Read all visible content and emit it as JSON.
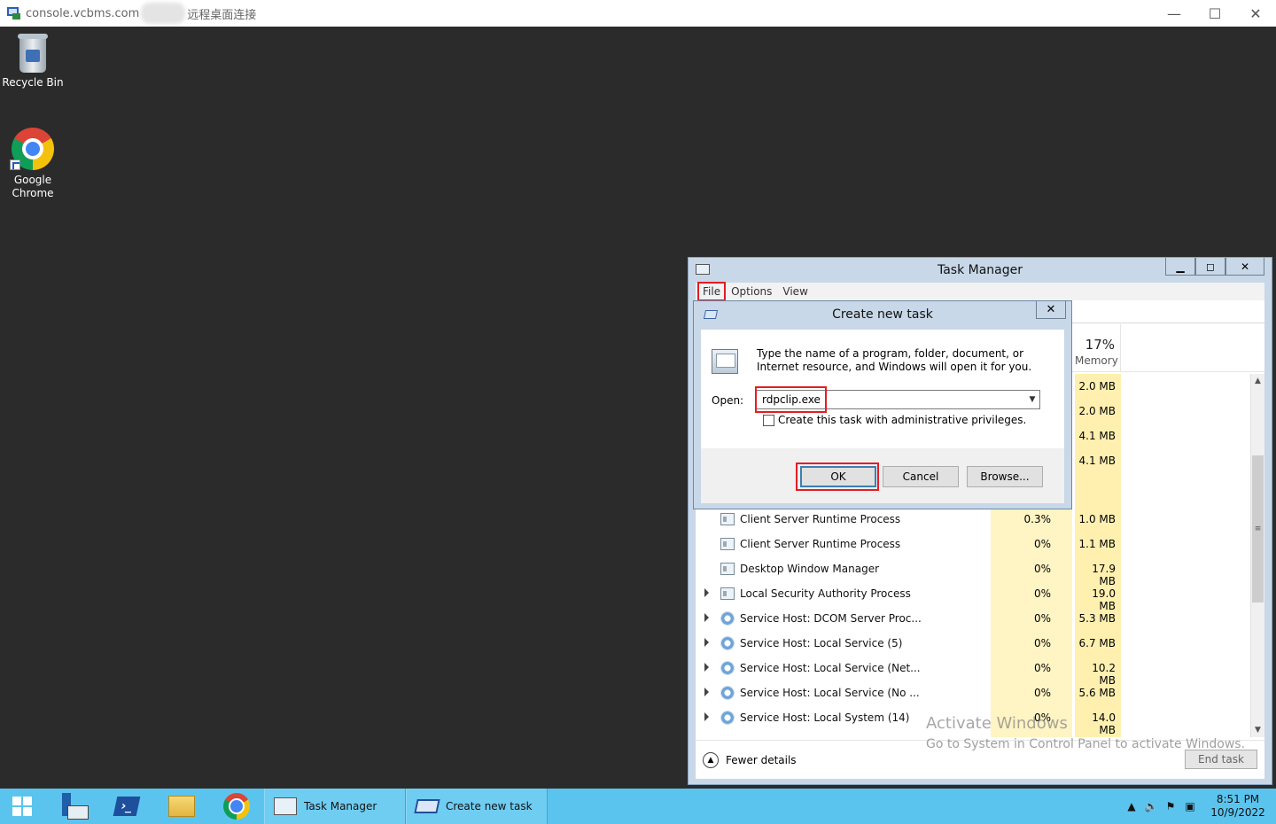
{
  "rdp": {
    "title_prefix": "console.vcbms.com",
    "title_suffix": "远程桌面连接",
    "minimize": "—",
    "maximize": "☐",
    "close": "✕"
  },
  "desktop": {
    "icons": [
      {
        "label": "Recycle Bin"
      },
      {
        "label": "Google Chrome"
      }
    ]
  },
  "task_manager": {
    "title": "Task Manager",
    "menu": {
      "file": "File",
      "options": "Options",
      "view": "View"
    },
    "memory_pct": "17%",
    "memory_label": "Memory",
    "rows_top_mem": [
      "2.0 MB",
      "2.0 MB",
      "4.1 MB",
      "4.1 MB"
    ],
    "processes": [
      {
        "name": "Client Server Runtime Process",
        "cpu": "0.3%",
        "mem": "1.0 MB",
        "expandable": false,
        "icon": "window-icon"
      },
      {
        "name": "Client Server Runtime Process",
        "cpu": "0%",
        "mem": "1.1 MB",
        "expandable": false,
        "icon": "window-icon"
      },
      {
        "name": "Desktop Window Manager",
        "cpu": "0%",
        "mem": "17.9 MB",
        "expandable": false,
        "icon": "window-icon"
      },
      {
        "name": "Local Security Authority Process",
        "cpu": "0%",
        "mem": "19.0 MB",
        "expandable": true,
        "icon": "window-icon"
      },
      {
        "name": "Service Host: DCOM Server Proc...",
        "cpu": "0%",
        "mem": "5.3 MB",
        "expandable": true,
        "icon": "gear-icon"
      },
      {
        "name": "Service Host: Local Service (5)",
        "cpu": "0%",
        "mem": "6.7 MB",
        "expandable": true,
        "icon": "gear-icon"
      },
      {
        "name": "Service Host: Local Service (Net...",
        "cpu": "0%",
        "mem": "10.2 MB",
        "expandable": true,
        "icon": "gear-icon"
      },
      {
        "name": "Service Host: Local Service (No ...",
        "cpu": "0%",
        "mem": "5.6 MB",
        "expandable": true,
        "icon": "gear-icon"
      },
      {
        "name": "Service Host: Local System (14)",
        "cpu": "0%",
        "mem": "14.0 MB",
        "expandable": true,
        "icon": "gear-icon"
      }
    ],
    "fewer_details": "Fewer details",
    "end_task": "End task"
  },
  "activation": {
    "line1": "Activate Windows",
    "line2": "Go to System in Control Panel to activate Windows."
  },
  "dialog": {
    "title": "Create new task",
    "close": "✕",
    "description": "Type the name of a program, folder, document, or Internet resource, and Windows will open it for you.",
    "open_label": "Open:",
    "open_value": "rdpclip.exe",
    "admin_checkbox": "Create this task with administrative privileges.",
    "ok": "OK",
    "cancel": "Cancel",
    "browse": "Browse..."
  },
  "taskbar": {
    "tasks": [
      {
        "label": "Task Manager"
      },
      {
        "label": "Create new task"
      }
    ],
    "time": "8:51 PM",
    "date": "10/9/2022"
  },
  "colors": {
    "highlight": "#e51c23",
    "taskbar": "#5bc4ee",
    "desktop": "#2b2b2b"
  }
}
